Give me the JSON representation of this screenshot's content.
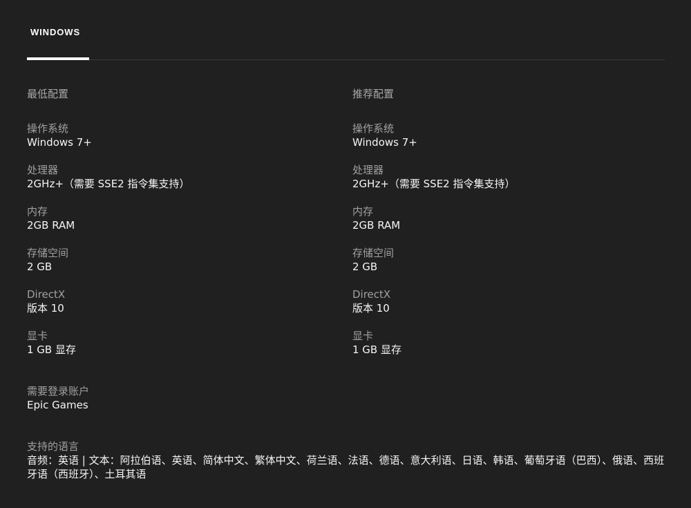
{
  "tabs": [
    {
      "label": "WINDOWS",
      "active": true
    }
  ],
  "min_spec": {
    "heading": "最低配置",
    "items": [
      {
        "label": "操作系统",
        "value": "Windows 7+"
      },
      {
        "label": "处理器",
        "value": "2GHz+（需要 SSE2 指令集支持）"
      },
      {
        "label": "内存",
        "value": "2GB RAM"
      },
      {
        "label": "存储空间",
        "value": "2 GB"
      },
      {
        "label": "DirectX",
        "value": "版本 10"
      },
      {
        "label": "显卡",
        "value": "1 GB 显存"
      }
    ]
  },
  "rec_spec": {
    "heading": "推荐配置",
    "items": [
      {
        "label": "操作系统",
        "value": "Windows 7+"
      },
      {
        "label": "处理器",
        "value": "2GHz+（需要 SSE2 指令集支持）"
      },
      {
        "label": "内存",
        "value": "2GB RAM"
      },
      {
        "label": "存储空间",
        "value": "2 GB"
      },
      {
        "label": "DirectX",
        "value": "版本 10"
      },
      {
        "label": "显卡",
        "value": "1 GB 显存"
      }
    ]
  },
  "account": {
    "label": "需要登录账户",
    "value": "Epic Games"
  },
  "languages": {
    "label": "支持的语言",
    "value": "音频：英语 | 文本：阿拉伯语、英语、简体中文、繁体中文、荷兰语、法语、德语、意大利语、日语、韩语、葡萄牙语（巴西）、俄语、西班牙语（西班牙）、土耳其语"
  },
  "colors": {
    "background": "#202020",
    "label": "#a0a0a0",
    "value": "#f5f5f5",
    "active_tab_indicator": "#ffffff"
  }
}
